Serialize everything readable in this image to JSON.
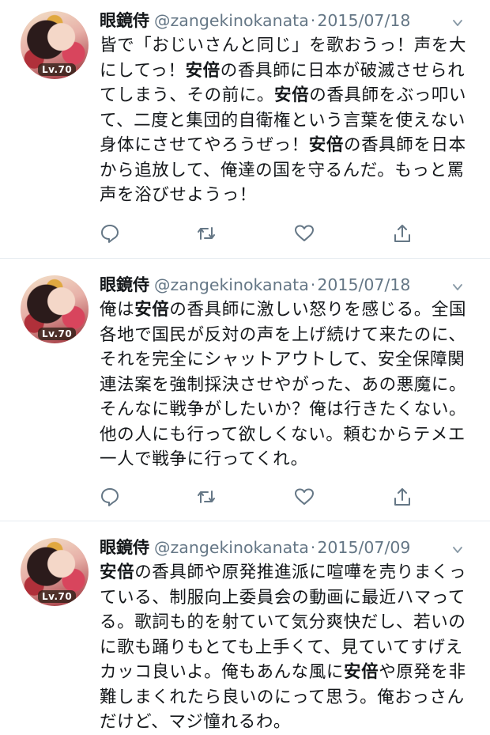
{
  "tweets": [
    {
      "display_name": "眼鏡侍",
      "handle": "@zangekinokanata",
      "separator": "·",
      "date": "2015/07/18",
      "avatar_badge": "Lv.70",
      "segments": [
        {
          "text": "皆で「おじいさんと同じ」を歌おうっ！声を大にしてっ！",
          "bold": false
        },
        {
          "text": "安倍",
          "bold": true
        },
        {
          "text": "の香具師に日本が破滅させられてしまう、その前に。",
          "bold": false
        },
        {
          "text": "安倍",
          "bold": true
        },
        {
          "text": "の香具師をぶっ叩いて、二度と集団的自衛権という言葉を使えない身体にさせてやろうぜっ！",
          "bold": false
        },
        {
          "text": "安倍",
          "bold": true
        },
        {
          "text": "の香具師を日本から追放して、俺達の国を守るんだ。もっと罵声を浴びせようっ！",
          "bold": false
        }
      ]
    },
    {
      "display_name": "眼鏡侍",
      "handle": "@zangekinokanata",
      "separator": "·",
      "date": "2015/07/18",
      "avatar_badge": "Lv.70",
      "segments": [
        {
          "text": "俺は",
          "bold": false
        },
        {
          "text": "安倍",
          "bold": true
        },
        {
          "text": "の香具師に激しい怒りを感じる。全国各地で国民が反対の声を上げ続けて来たのに、それを完全にシャットアウトして、安全保障関連法案を強制採決させやがった、あの悪魔に。そんなに戦争がしたいか？俺は行きたくない。他の人にも行って欲しくない。頼むからテメエ一人で戦争に行ってくれ。",
          "bold": false
        }
      ]
    },
    {
      "display_name": "眼鏡侍",
      "handle": "@zangekinokanata",
      "separator": "·",
      "date": "2015/07/09",
      "avatar_badge": "Lv.70",
      "segments": [
        {
          "text": "安倍",
          "bold": true
        },
        {
          "text": "の香具師や原発推進派に喧嘩を売りまくっている、制服向上委員会の動画に最近ハマってる。歌詞も的を射ていて気分爽快だし、若いのに歌も踊りもとても上手くて、見ていてすげえカッコ良いよ。俺もあんな風に",
          "bold": false
        },
        {
          "text": "安倍",
          "bold": true
        },
        {
          "text": "や原発を非難しまくれたら良いのにって思う。俺おっさんだけど、マジ憧れるわ。",
          "bold": false
        }
      ]
    }
  ],
  "icons": {
    "reply": "reply-icon",
    "retweet": "retweet-icon",
    "like": "heart-icon",
    "share": "share-icon",
    "menu": "chevron-down-icon"
  },
  "colors": {
    "text": "#14171a",
    "secondary": "#657786",
    "divider": "#e6ecf0"
  }
}
